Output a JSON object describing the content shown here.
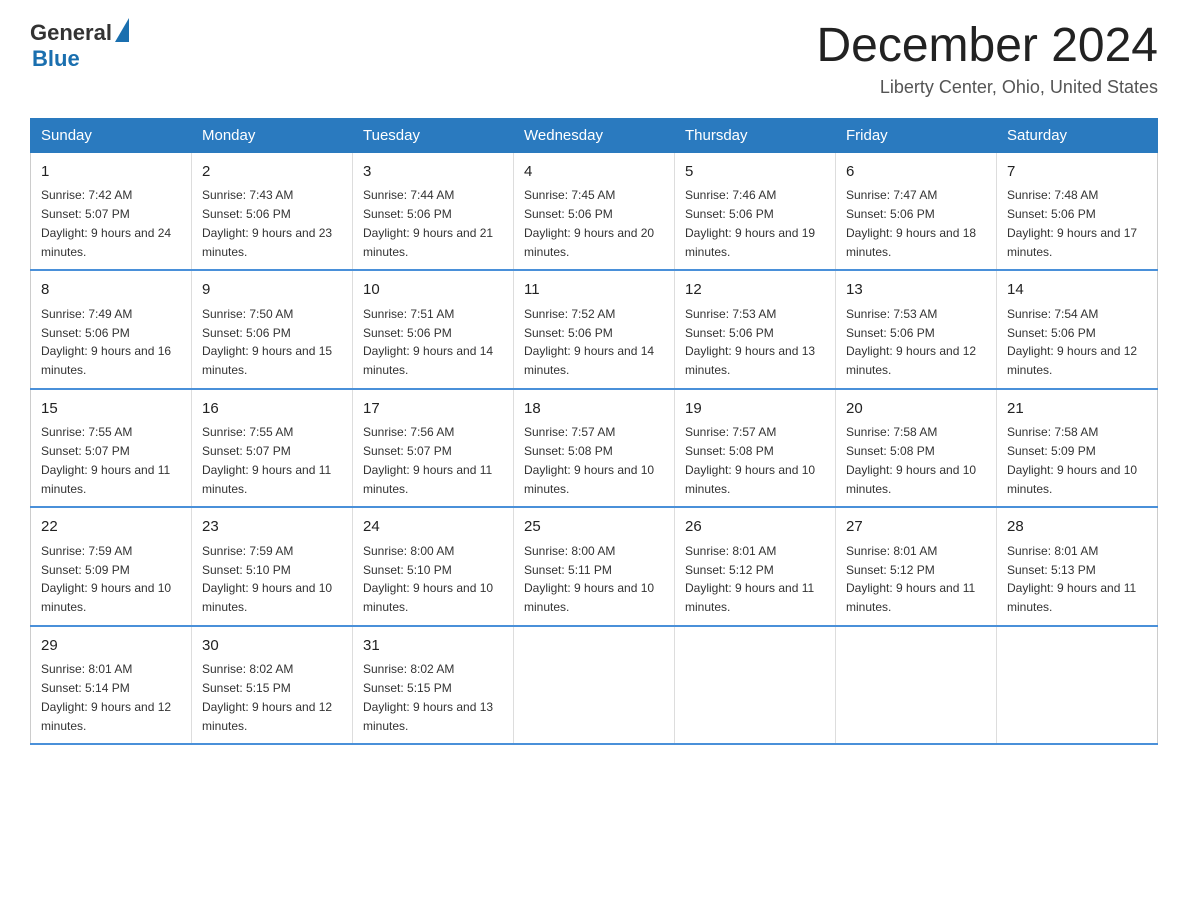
{
  "header": {
    "logo_general": "General",
    "logo_blue": "Blue",
    "month_title": "December 2024",
    "location": "Liberty Center, Ohio, United States"
  },
  "weekdays": [
    "Sunday",
    "Monday",
    "Tuesday",
    "Wednesday",
    "Thursday",
    "Friday",
    "Saturday"
  ],
  "weeks": [
    [
      {
        "day": "1",
        "sunrise": "7:42 AM",
        "sunset": "5:07 PM",
        "daylight": "9 hours and 24 minutes."
      },
      {
        "day": "2",
        "sunrise": "7:43 AM",
        "sunset": "5:06 PM",
        "daylight": "9 hours and 23 minutes."
      },
      {
        "day": "3",
        "sunrise": "7:44 AM",
        "sunset": "5:06 PM",
        "daylight": "9 hours and 21 minutes."
      },
      {
        "day": "4",
        "sunrise": "7:45 AM",
        "sunset": "5:06 PM",
        "daylight": "9 hours and 20 minutes."
      },
      {
        "day": "5",
        "sunrise": "7:46 AM",
        "sunset": "5:06 PM",
        "daylight": "9 hours and 19 minutes."
      },
      {
        "day": "6",
        "sunrise": "7:47 AM",
        "sunset": "5:06 PM",
        "daylight": "9 hours and 18 minutes."
      },
      {
        "day": "7",
        "sunrise": "7:48 AM",
        "sunset": "5:06 PM",
        "daylight": "9 hours and 17 minutes."
      }
    ],
    [
      {
        "day": "8",
        "sunrise": "7:49 AM",
        "sunset": "5:06 PM",
        "daylight": "9 hours and 16 minutes."
      },
      {
        "day": "9",
        "sunrise": "7:50 AM",
        "sunset": "5:06 PM",
        "daylight": "9 hours and 15 minutes."
      },
      {
        "day": "10",
        "sunrise": "7:51 AM",
        "sunset": "5:06 PM",
        "daylight": "9 hours and 14 minutes."
      },
      {
        "day": "11",
        "sunrise": "7:52 AM",
        "sunset": "5:06 PM",
        "daylight": "9 hours and 14 minutes."
      },
      {
        "day": "12",
        "sunrise": "7:53 AM",
        "sunset": "5:06 PM",
        "daylight": "9 hours and 13 minutes."
      },
      {
        "day": "13",
        "sunrise": "7:53 AM",
        "sunset": "5:06 PM",
        "daylight": "9 hours and 12 minutes."
      },
      {
        "day": "14",
        "sunrise": "7:54 AM",
        "sunset": "5:06 PM",
        "daylight": "9 hours and 12 minutes."
      }
    ],
    [
      {
        "day": "15",
        "sunrise": "7:55 AM",
        "sunset": "5:07 PM",
        "daylight": "9 hours and 11 minutes."
      },
      {
        "day": "16",
        "sunrise": "7:55 AM",
        "sunset": "5:07 PM",
        "daylight": "9 hours and 11 minutes."
      },
      {
        "day": "17",
        "sunrise": "7:56 AM",
        "sunset": "5:07 PM",
        "daylight": "9 hours and 11 minutes."
      },
      {
        "day": "18",
        "sunrise": "7:57 AM",
        "sunset": "5:08 PM",
        "daylight": "9 hours and 10 minutes."
      },
      {
        "day": "19",
        "sunrise": "7:57 AM",
        "sunset": "5:08 PM",
        "daylight": "9 hours and 10 minutes."
      },
      {
        "day": "20",
        "sunrise": "7:58 AM",
        "sunset": "5:08 PM",
        "daylight": "9 hours and 10 minutes."
      },
      {
        "day": "21",
        "sunrise": "7:58 AM",
        "sunset": "5:09 PM",
        "daylight": "9 hours and 10 minutes."
      }
    ],
    [
      {
        "day": "22",
        "sunrise": "7:59 AM",
        "sunset": "5:09 PM",
        "daylight": "9 hours and 10 minutes."
      },
      {
        "day": "23",
        "sunrise": "7:59 AM",
        "sunset": "5:10 PM",
        "daylight": "9 hours and 10 minutes."
      },
      {
        "day": "24",
        "sunrise": "8:00 AM",
        "sunset": "5:10 PM",
        "daylight": "9 hours and 10 minutes."
      },
      {
        "day": "25",
        "sunrise": "8:00 AM",
        "sunset": "5:11 PM",
        "daylight": "9 hours and 10 minutes."
      },
      {
        "day": "26",
        "sunrise": "8:01 AM",
        "sunset": "5:12 PM",
        "daylight": "9 hours and 11 minutes."
      },
      {
        "day": "27",
        "sunrise": "8:01 AM",
        "sunset": "5:12 PM",
        "daylight": "9 hours and 11 minutes."
      },
      {
        "day": "28",
        "sunrise": "8:01 AM",
        "sunset": "5:13 PM",
        "daylight": "9 hours and 11 minutes."
      }
    ],
    [
      {
        "day": "29",
        "sunrise": "8:01 AM",
        "sunset": "5:14 PM",
        "daylight": "9 hours and 12 minutes."
      },
      {
        "day": "30",
        "sunrise": "8:02 AM",
        "sunset": "5:15 PM",
        "daylight": "9 hours and 12 minutes."
      },
      {
        "day": "31",
        "sunrise": "8:02 AM",
        "sunset": "5:15 PM",
        "daylight": "9 hours and 13 minutes."
      },
      null,
      null,
      null,
      null
    ]
  ]
}
